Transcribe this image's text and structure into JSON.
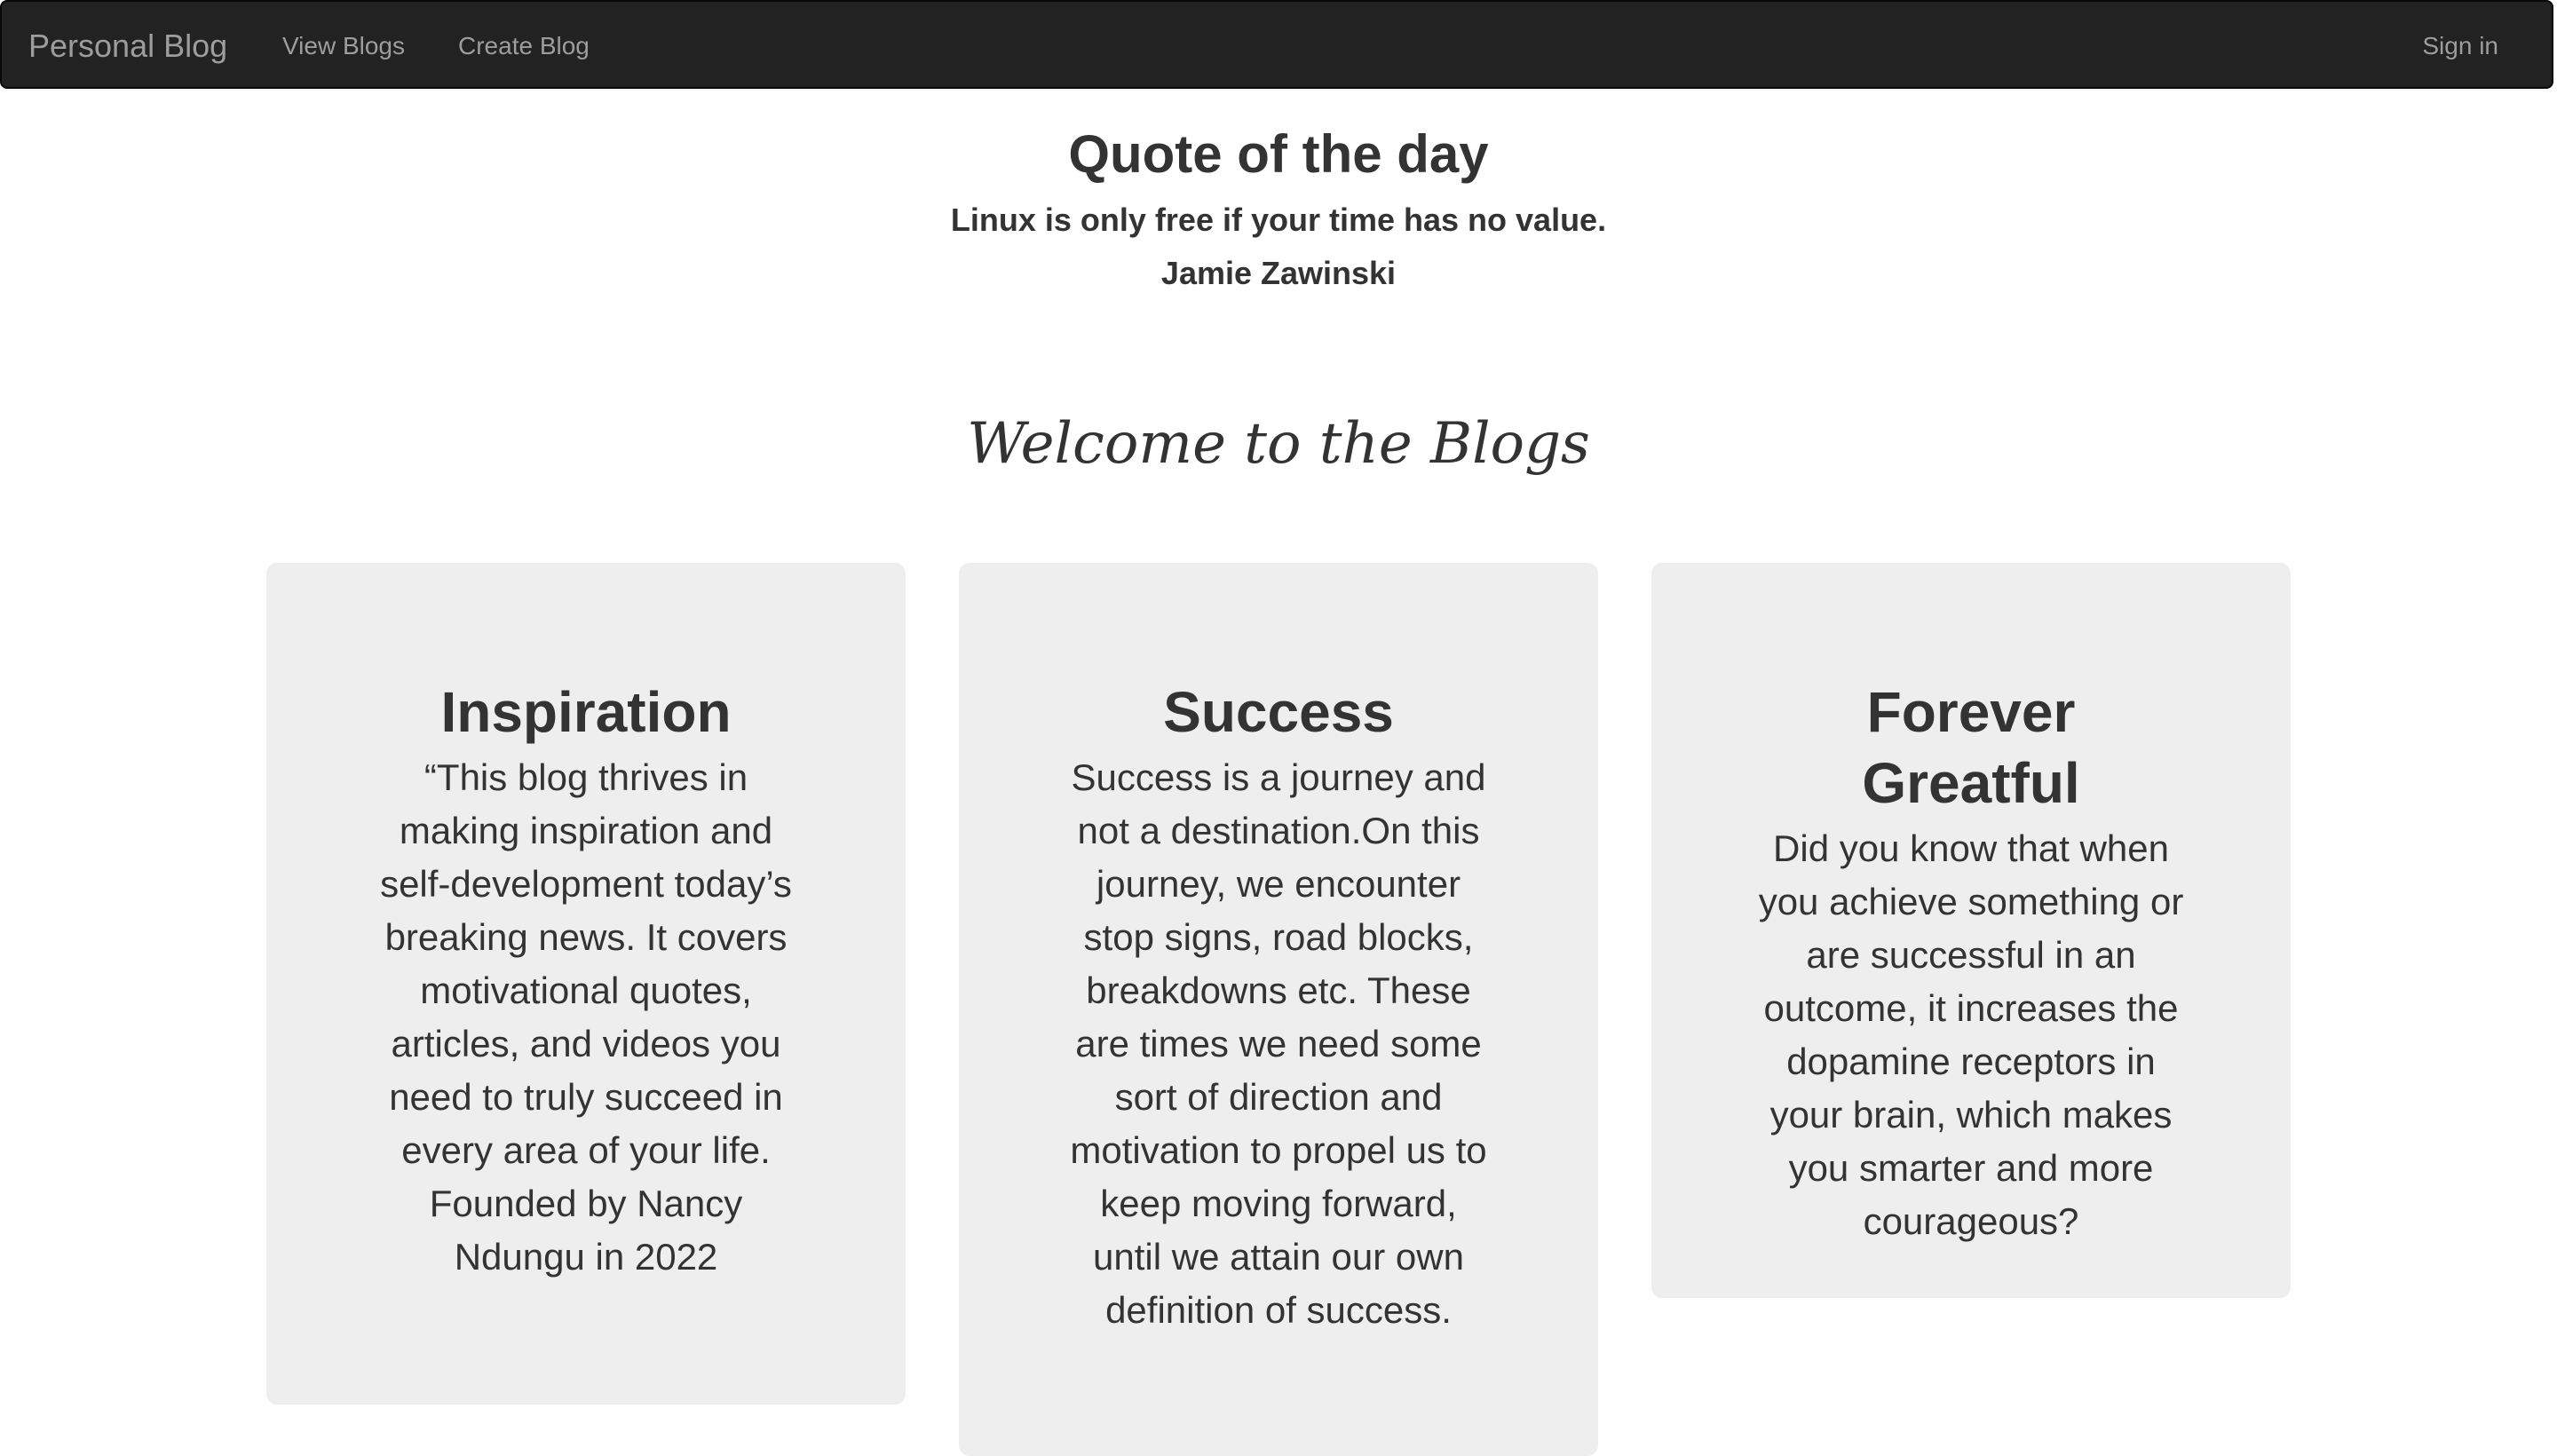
{
  "navbar": {
    "brand": "Personal Blog",
    "links": [
      {
        "label": "View Blogs"
      },
      {
        "label": "Create Blog"
      }
    ],
    "signin": "Sign in"
  },
  "quote": {
    "heading": "Quote of the day",
    "text": "Linux is only free if your time has no value.",
    "author": "Jamie Zawinski"
  },
  "welcome": "Welcome to the Blogs",
  "cards": [
    {
      "title": "Inspiration",
      "body": "“This blog thrives in making inspiration and self-development today’s breaking news. It covers motivational quotes, articles, and videos you need to truly succeed in every area of your life. Founded by Nancy Ndungu in 2022"
    },
    {
      "title": "Success",
      "body": "Success is a journey and not a destination.On this journey, we encounter stop signs, road blocks, breakdowns etc. These are times we need some sort of direction and motivation to propel us to keep moving forward, until we attain our own definition of success."
    },
    {
      "title": "Forever Greatful",
      "body": "Did you know that when you achieve something or are successful in an outcome, it increases the dopamine receptors in your brain, which makes you smarter and more courageous?"
    }
  ],
  "colors": {
    "navbar_bg": "#222222",
    "nav_text": "#9d9d9d",
    "card_bg": "#eeeeee",
    "text": "#333333"
  }
}
